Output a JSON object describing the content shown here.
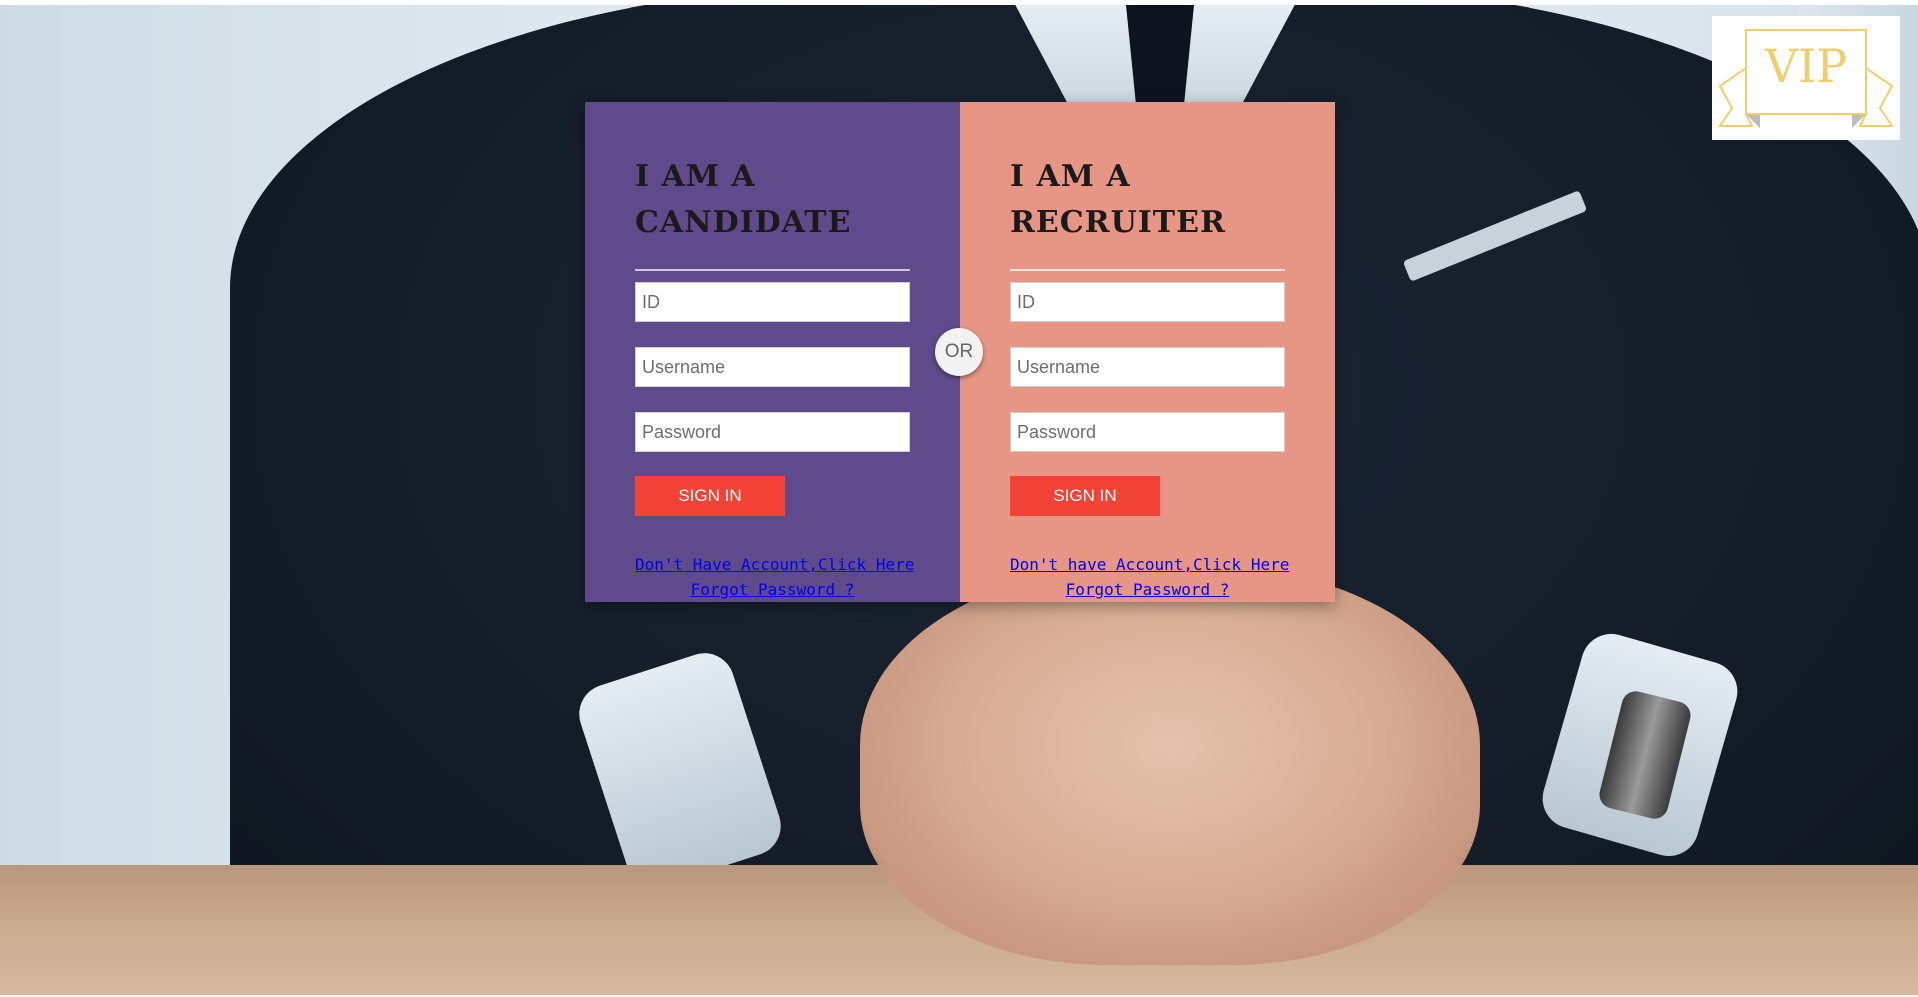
{
  "logo": {
    "text": "VIP"
  },
  "candidate": {
    "heading": "I AM A CANDIDATE",
    "id_placeholder": "ID",
    "username_placeholder": "Username",
    "password_placeholder": "Password",
    "signin_label": "SIGN IN",
    "signup_link": "Don't Have Account,Click Here",
    "forgot_link": "Forgot Password ?"
  },
  "separator": {
    "label": "OR"
  },
  "recruiter": {
    "heading": "I AM A RECRUITER",
    "id_placeholder": "ID",
    "username_placeholder": "Username",
    "password_placeholder": "Password",
    "signin_label": "SIGN IN",
    "signup_link": "Don't have Account,Click Here",
    "forgot_link": "Forgot Password ?"
  },
  "colors": {
    "candidate_panel": "#5f4b8b",
    "recruiter_panel": "#e79686",
    "signin_button": "#f34236",
    "link": "#0000ee",
    "logo_gold": "#f0cf6a"
  }
}
